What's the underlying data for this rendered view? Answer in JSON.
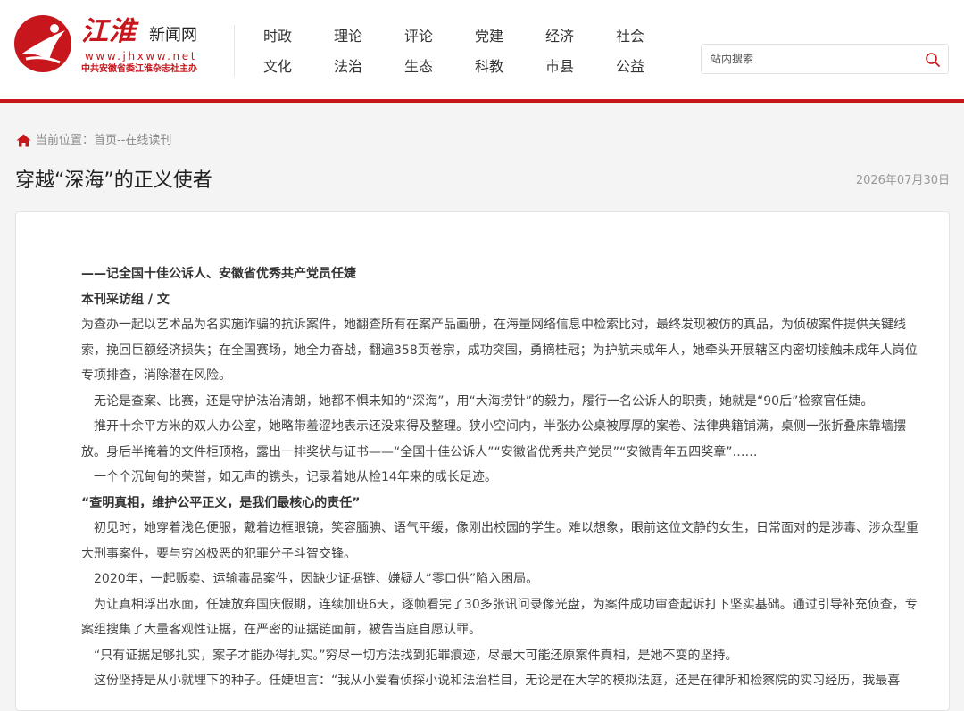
{
  "site": {
    "logo_name": "江淮",
    "logo_sub": "新闻网",
    "logo_url": "www.jhxww.net",
    "logo_org": "中共安徽省委江淮杂志社主办",
    "accent": "#c8161d"
  },
  "nav": {
    "row1": [
      "时政",
      "理论",
      "评论",
      "党建",
      "经济",
      "社会"
    ],
    "row2": [
      "文化",
      "法治",
      "生态",
      "科教",
      "市县",
      "公益"
    ]
  },
  "search": {
    "placeholder": "站内搜索",
    "icon": "search-icon"
  },
  "breadcrumb": {
    "icon": "home-icon",
    "label": "当前位置：首页--在线读刊"
  },
  "article": {
    "title": "穿越“深海”的正义使者",
    "date": "2026年07月30日",
    "subtitle": "——记全国十佳公诉人、安徽省优秀共产党员任婕",
    "byline": "本刊采访组 / 文",
    "p1": "为查办一起以艺术品为名实施诈骗的抗诉案件，她翻查所有在案产品画册，在海量网络信息中检索比对，最终发现被仿的真品，为侦破案件提供关键线索，挽回巨额经济损失；在全国赛场，她全力奋战，翻遍358页卷宗，成功突围，勇摘桂冠；为护航未成年人，她牵头开展辖区内密切接触未成年人岗位专项排查，消除潜在风险。",
    "p2": "无论是查案、比赛，还是守护法治清朗，她都不惧未知的“深海”，用“大海捞针”的毅力，履行一名公诉人的职责，她就是“90后”检察官任婕。",
    "p3": "推开十余平方米的双人办公室，她略带羞涩地表示还没来得及整理。狭小空间内，半张办公桌被厚厚的案卷、法律典籍铺满，桌侧一张折叠床靠墙摆放。身后半掩着的文件柜顶格，露出一排奖状与证书——“全国十佳公诉人”“安徽省优秀共产党员”“安徽青年五四奖章”……",
    "p4": "一个个沉甸甸的荣誉，如无声的镌头，记录着她从检14年来的成长足迹。",
    "heading": "“查明真相，维护公平正义，是我们最核心的责任”",
    "p5": "初见时，她穿着浅色便服，戴着边框眼镜，笑容腼腆、语气平缓，像刚出校园的学生。难以想象，眼前这位文静的女生，日常面对的是涉毒、涉众型重大刑事案件，要与穷凶极恶的犯罪分子斗智交锋。",
    "p6": "2020年，一起贩卖、运输毒品案件，因缺少证据链、嫌疑人“零口供”陷入困局。",
    "p7": "为让真相浮出水面，任婕放弃国庆假期，连续加班6天，逐帧看完了30多张讯问录像光盘，为案件成功审查起诉打下坚实基础。通过引导补充侦查，专案组搜集了大量客观性证据，在严密的证据链面前，被告当庭自愿认罪。",
    "p8": "“只有证据足够扎实，案子才能办得扎实。”穷尽一切方法找到犯罪痕迹，尽最大可能还原案件真相，是她不变的坚持。",
    "p9": "这份坚持是从小就埋下的种子。任婕坦言：“我从小爱看侦探小说和法治栏目，无论是在大学的模拟法庭，还是在律所和检察院的实习经历，我最喜"
  }
}
